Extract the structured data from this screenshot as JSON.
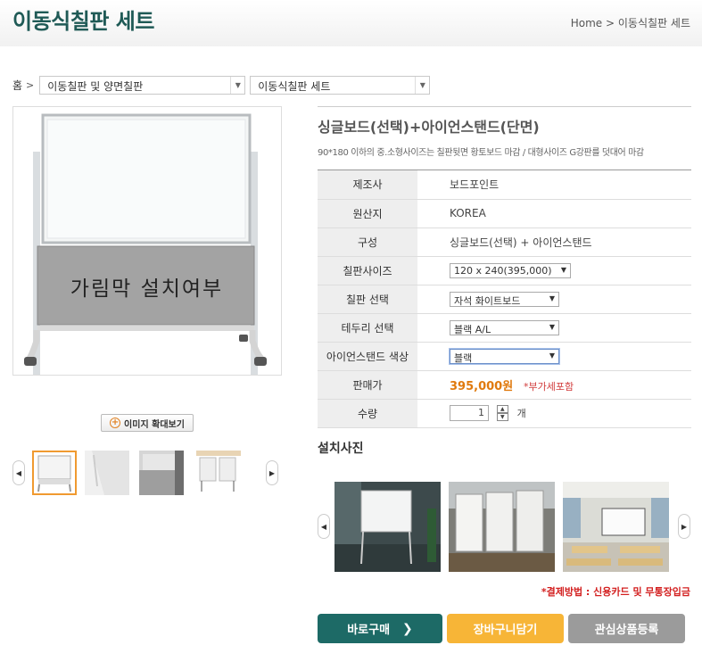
{
  "header": {
    "title": "이동식칠판 세트",
    "breadcrumb_home": "Home",
    "breadcrumb_sep": ">",
    "breadcrumb_current": "이동식칠판 세트"
  },
  "nav": {
    "home": "홈",
    "sep": ">",
    "category": "이동칠판 및 양면칠판",
    "subcategory": "이동식칠판 세트"
  },
  "gallery": {
    "main_overlay": "가림막 설치여부",
    "zoom_label": "이미지 확대보기",
    "active_thumb": 0
  },
  "product": {
    "name": "싱글보드(선택)+아이언스탠드(단면)",
    "description": "90*180 이하의 중.소형사이즈는 칠판뒷면 황토보드 마감 / 대형사이즈 G강판를 덧대어 마감"
  },
  "spec": {
    "maker_label": "제조사",
    "maker": "보드포인트",
    "origin_label": "원산지",
    "origin": "KOREA",
    "composition_label": "구성",
    "composition": "싱글보드(선택) + 아이언스탠드",
    "size_label": "칠판사이즈",
    "size": "120 x 240(395,000)",
    "board_label": "칠판 선택",
    "board": "자석 화이트보드",
    "border_label": "테두리 선택",
    "border": "블랙 A/L",
    "stand_label": "아이언스탠드 색상",
    "stand": "블랙",
    "price_label": "판매가",
    "price": "395,000원",
    "vat": "*부가세포함",
    "qty_label": "수량",
    "qty": "1",
    "qty_unit": "개"
  },
  "install": {
    "title": "설치사진"
  },
  "payment_note": "*결제방법 : 신용카드 및 무통장입금",
  "buttons": {
    "buy": "바로구매",
    "cart": "장바구니담기",
    "wish": "관심상품등록"
  },
  "colors": {
    "brand": "#1d6a66",
    "cart": "#f7b537",
    "wish": "#9b9b9b",
    "price": "#e07a0e",
    "active_thumb": "#f09a30"
  }
}
